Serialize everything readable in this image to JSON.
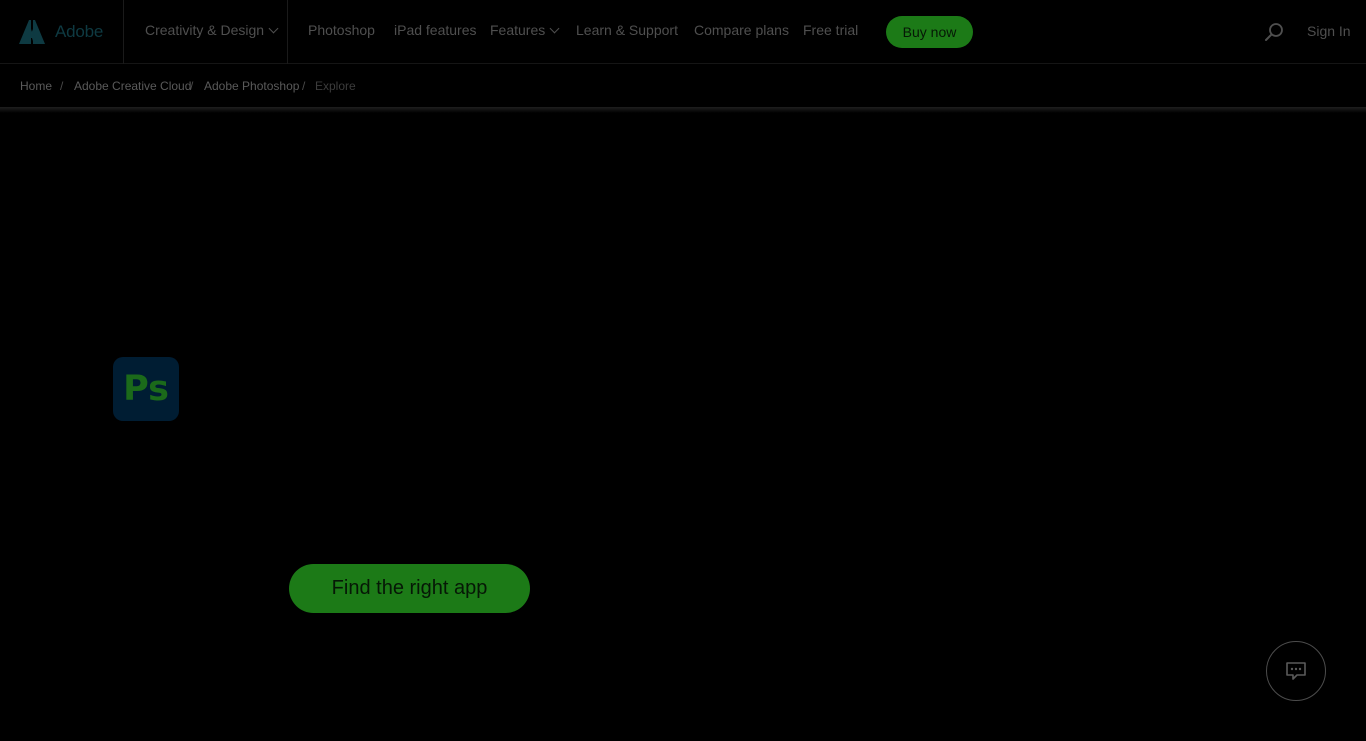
{
  "brand": {
    "name": "Adobe",
    "logo_icon": "adobe-logo-icon",
    "logo_color": "#0e3a42"
  },
  "nav": {
    "creativity": "Creativity & Design",
    "photoshop": "Photoshop",
    "ipad": "iPad features",
    "features": "Features",
    "learn": "Learn & Support",
    "compare": "Compare plans",
    "free_trial": "Free trial",
    "buy_now": "Buy now",
    "sign_in": "Sign In",
    "search_icon": "search-icon"
  },
  "breadcrumb": {
    "items": [
      "Home",
      "Adobe Creative Cloud",
      "Adobe Photoshop",
      "Explore"
    ],
    "separator": "/"
  },
  "hero": {
    "app_icon_text": "Ps",
    "cta": "Find the right app"
  },
  "chat": {
    "icon": "chat-icon"
  },
  "colors": {
    "background": "#000000",
    "accent_green": "#1c7a17",
    "ps_icon_bg": "#001d33"
  }
}
